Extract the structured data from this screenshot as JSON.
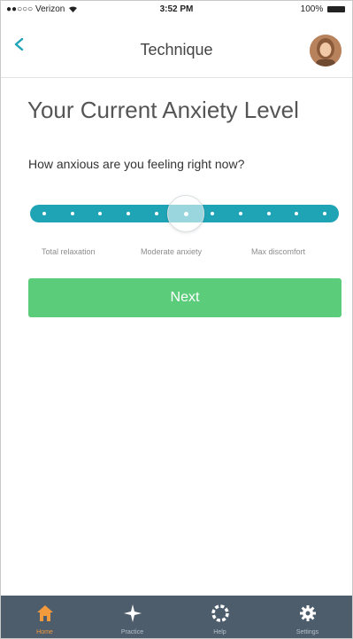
{
  "status_bar": {
    "carrier": "●●○○○ Verizon",
    "time": "3:52 PM",
    "battery": "100%"
  },
  "nav": {
    "title": "Technique"
  },
  "content": {
    "headline": "Your Current Anxiety Level",
    "question": "How anxious are you feeling right now?",
    "slider": {
      "steps": 11,
      "selected_index": 5,
      "labels": [
        "Total relaxation",
        "Moderate anxiety",
        "Max discomfort"
      ]
    },
    "next_label": "Next"
  },
  "tabbar": {
    "items": [
      {
        "label": "Home",
        "icon": "home-icon",
        "active": true
      },
      {
        "label": "Practice",
        "icon": "sparkle-icon",
        "active": false
      },
      {
        "label": "Help",
        "icon": "lifebuoy-icon",
        "active": false
      },
      {
        "label": "Settings",
        "icon": "gear-icon",
        "active": false
      }
    ]
  },
  "colors": {
    "accent": "#1fa4b6",
    "button": "#5bcc7a",
    "tabbar": "#4e5d6c",
    "active_tab": "#f39a3c"
  }
}
